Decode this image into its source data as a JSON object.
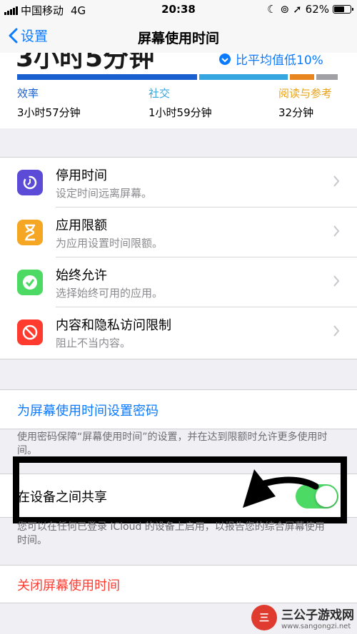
{
  "status_bar": {
    "carrier": "中国移动",
    "network": "4G",
    "time": "20:38",
    "battery": "62%"
  },
  "nav": {
    "back_label": "设置",
    "title": "屏幕使用时间"
  },
  "summary": {
    "total_time_partial": "3小时5分钟",
    "comparison_partial": "比平均值低10%",
    "bar_colors": [
      "#1a5fd0",
      "#35a6e0",
      "#e8851e",
      "#a0a0a5"
    ],
    "categories": [
      {
        "label": "效率",
        "value": "3小时57分钟",
        "color": "#1a5fd0"
      },
      {
        "label": "社交",
        "value": "1小时59分钟",
        "color": "#35a6e0"
      },
      {
        "label": "阅读与参考",
        "value": "32分钟",
        "color": "#e8a317"
      }
    ]
  },
  "settings": [
    {
      "title": "停用时间",
      "subtitle": "设定时间远离屏幕。",
      "icon": "downtime-icon",
      "color": "#5b4bd6"
    },
    {
      "title": "应用限额",
      "subtitle": "为应用设置时间限额。",
      "icon": "hourglass-icon",
      "color": "#f5a623"
    },
    {
      "title": "始终允许",
      "subtitle": "选择始终可用的应用。",
      "icon": "checkmark-badge-icon",
      "color": "#4cd964"
    },
    {
      "title": "内容和隐私访问限制",
      "subtitle": "阻止不当内容。",
      "icon": "no-entry-icon",
      "color": "#ff3b30"
    }
  ],
  "passcode": {
    "label": "为屏幕使用时间设置密码",
    "note": "使用密码保障“屏幕使用时间”的设置，并在达到限额时允许更多使用时间。"
  },
  "share": {
    "label": "在设备之间共享",
    "enabled": true,
    "note": "您可以在任何已登录 iCloud 的设备上启用，以报告您的综合屏幕使用时间。"
  },
  "turn_off": {
    "label": "关闭屏幕使用时间"
  },
  "watermark": {
    "name": "三公子游戏网",
    "url": "www.sangongzi.net"
  }
}
